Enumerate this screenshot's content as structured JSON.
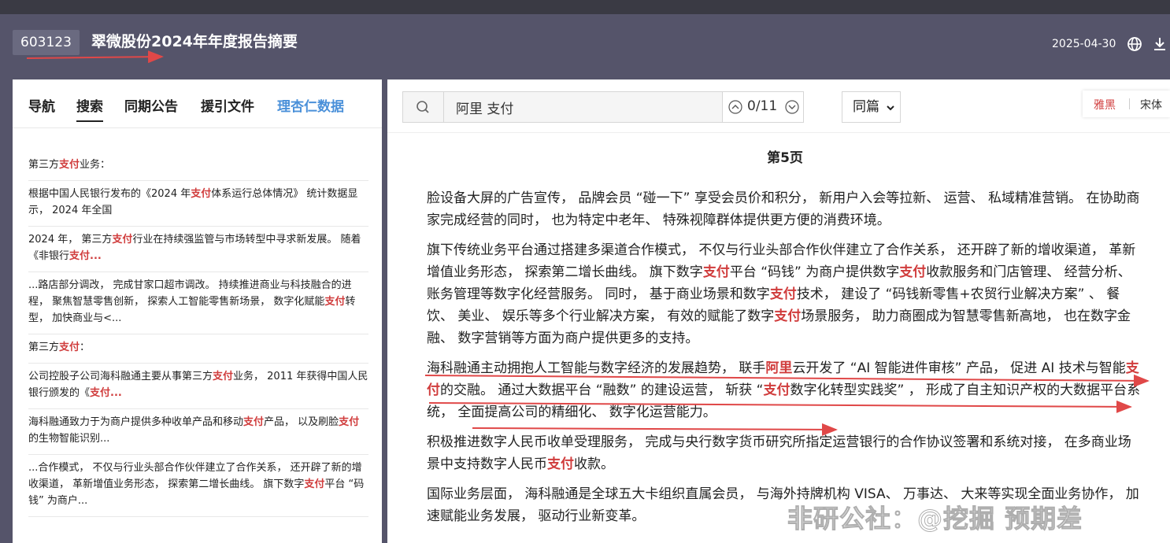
{
  "header": {
    "stock_code": "603123",
    "title": "翠微股份2024年年度报告摘要",
    "date": "2025-04-30",
    "icons": [
      "globe-icon",
      "download-icon"
    ]
  },
  "left_tabs": [
    "导航",
    "搜索",
    "同期公告",
    "援引文件",
    "理杏仁数据"
  ],
  "active_tab": "搜索",
  "results": [
    {
      "segments": [
        {
          "t": "第三方",
          "hl": false
        },
        {
          "t": "支付",
          "hl": true
        },
        {
          "t": "业务：",
          "hl": false
        }
      ]
    },
    {
      "segments": [
        {
          "t": "根据中国人民银行发布的《2024 年",
          "hl": false
        },
        {
          "t": "支付",
          "hl": true
        },
        {
          "t": "体系运行总体情况》 统计数据显示， 2024 年全国",
          "hl": false
        }
      ]
    },
    {
      "segments": [
        {
          "t": "2024 年， 第三方",
          "hl": false
        },
        {
          "t": "支付",
          "hl": true
        },
        {
          "t": "行业在持续强监管与市场转型中寻求新发展。 随着《非银行",
          "hl": false
        },
        {
          "t": "支付...",
          "hl": true
        }
      ]
    },
    {
      "segments": [
        {
          "t": "...路店部分调改， 完成甘家口超市调改。 持续推进商业与科技融合的进程， 聚焦智慧零售创新， 探索人工智能零售新场景， 数字化赋能",
          "hl": false
        },
        {
          "t": "支付",
          "hl": true
        },
        {
          "t": "转型， 加快商业与<...",
          "hl": false
        }
      ]
    },
    {
      "segments": [
        {
          "t": "第三方",
          "hl": false
        },
        {
          "t": "支付",
          "hl": true
        },
        {
          "t": "：",
          "hl": false
        }
      ]
    },
    {
      "segments": [
        {
          "t": "公司控股子公司海科融通主要从事第三方",
          "hl": false
        },
        {
          "t": "支付",
          "hl": true
        },
        {
          "t": "业务， 2011 年获得中国人民银行颁发的《",
          "hl": false
        },
        {
          "t": "支付...",
          "hl": true
        }
      ]
    },
    {
      "segments": [
        {
          "t": "海科融通致力于为商户提供多种收单产品和移动",
          "hl": false
        },
        {
          "t": "支付",
          "hl": true
        },
        {
          "t": "产品， 以及刷脸",
          "hl": false
        },
        {
          "t": "支付",
          "hl": true
        },
        {
          "t": "的生物智能识别...",
          "hl": false
        }
      ]
    },
    {
      "segments": [
        {
          "t": "...合作模式， 不仅与行业头部合作伙伴建立了合作关系， 还开辟了新的增收渠道， 革新增值业务形态， 探索第二增长曲线。 旗下数字",
          "hl": false
        },
        {
          "t": "支付",
          "hl": true
        },
        {
          "t": "平台 “码钱” 为商户...",
          "hl": false
        }
      ]
    }
  ],
  "search": {
    "query": "阿里 支付",
    "counter": "0/11",
    "scope": "同篇"
  },
  "font_switch": {
    "yahei": "雅黑",
    "songti": "宋体"
  },
  "page_label": "第5页",
  "paragraphs": [
    {
      "segments": [
        {
          "t": "脸设备大屏的广告宣传， 品牌会员 “碰一下” 享受会员价和积分， 新用户入会等拉新、 运营、 私域精准营销。 在协助商家完成经营的同时， 也为特定中老年、 特殊视障群体提供更方便的消费环境。",
          "hl": false
        }
      ]
    },
    {
      "segments": [
        {
          "t": "旗下传统业务平台通过搭建多渠道合作模式， 不仅与行业头部合作伙伴建立了合作关系， 还开辟了新的增收渠道， 革新增值业务形态， 探索第二增长曲线。 旗下数字",
          "hl": false
        },
        {
          "t": "支付",
          "hl": true
        },
        {
          "t": "平台 “码钱” 为商户提供数字",
          "hl": false
        },
        {
          "t": "支付",
          "hl": true
        },
        {
          "t": "收款服务和门店管理、 经营分析、 账务管理等数字化经营服务。 同时， 基于商业场景和数字",
          "hl": false
        },
        {
          "t": "支付",
          "hl": true
        },
        {
          "t": "技术， 建设了 “码钱新零售+农贸行业解决方案” 、 餐饮、 美业、 娱乐等多个行业解决方案， 有效的赋能了数字",
          "hl": false
        },
        {
          "t": "支付",
          "hl": true
        },
        {
          "t": "场景服务， 助力商圈成为智慧零售新高地， 也在数字金融、 数字营销等方面为商户提供更多的支持。",
          "hl": false
        }
      ]
    },
    {
      "segments": [
        {
          "t": "海科融通主动拥抱人工智能与数字经济的发展趋势， 联手",
          "hl": false
        },
        {
          "t": "阿里",
          "hl": true
        },
        {
          "t": "云开发了 “AI 智能进件审核” 产品， 促进 AI 技术与智能",
          "hl": false
        },
        {
          "t": "支付",
          "hl": true
        },
        {
          "t": "的交融。 通过大数据平台 “融数” 的建设运营， 斩获 “",
          "hl": false
        },
        {
          "t": "支付",
          "hl": true
        },
        {
          "t": "数字化转型实践奖” ， 形成了自主知识产权的大数据平台系统， 全面提高公司的精细化、 数字化运营能力。",
          "hl": false
        }
      ]
    },
    {
      "segments": [
        {
          "t": "积极推进数字人民币收单受理服务， 完成与央行数字货币研究所指定运营银行的合作协议签署和系统对接， 在多商业场景中支持数字人民币",
          "hl": false
        },
        {
          "t": "支付",
          "hl": true
        },
        {
          "t": "收款。",
          "hl": false
        }
      ]
    },
    {
      "segments": [
        {
          "t": "国际业务层面， 海科融通是全球五大卡组织直属会员， 与海外持牌机构 VISA、 万事达、 大来等实现全面业务协作， 加速赋能业务发展， 驱动行业新变革。",
          "hl": false
        }
      ]
    }
  ],
  "watermark": "非研公社：@挖掘 预期差",
  "colors": {
    "header_bg": "#55546a",
    "highlight": "#d03c3c",
    "annotation": "#e04848",
    "lixin_tab": "#4a90d9"
  }
}
